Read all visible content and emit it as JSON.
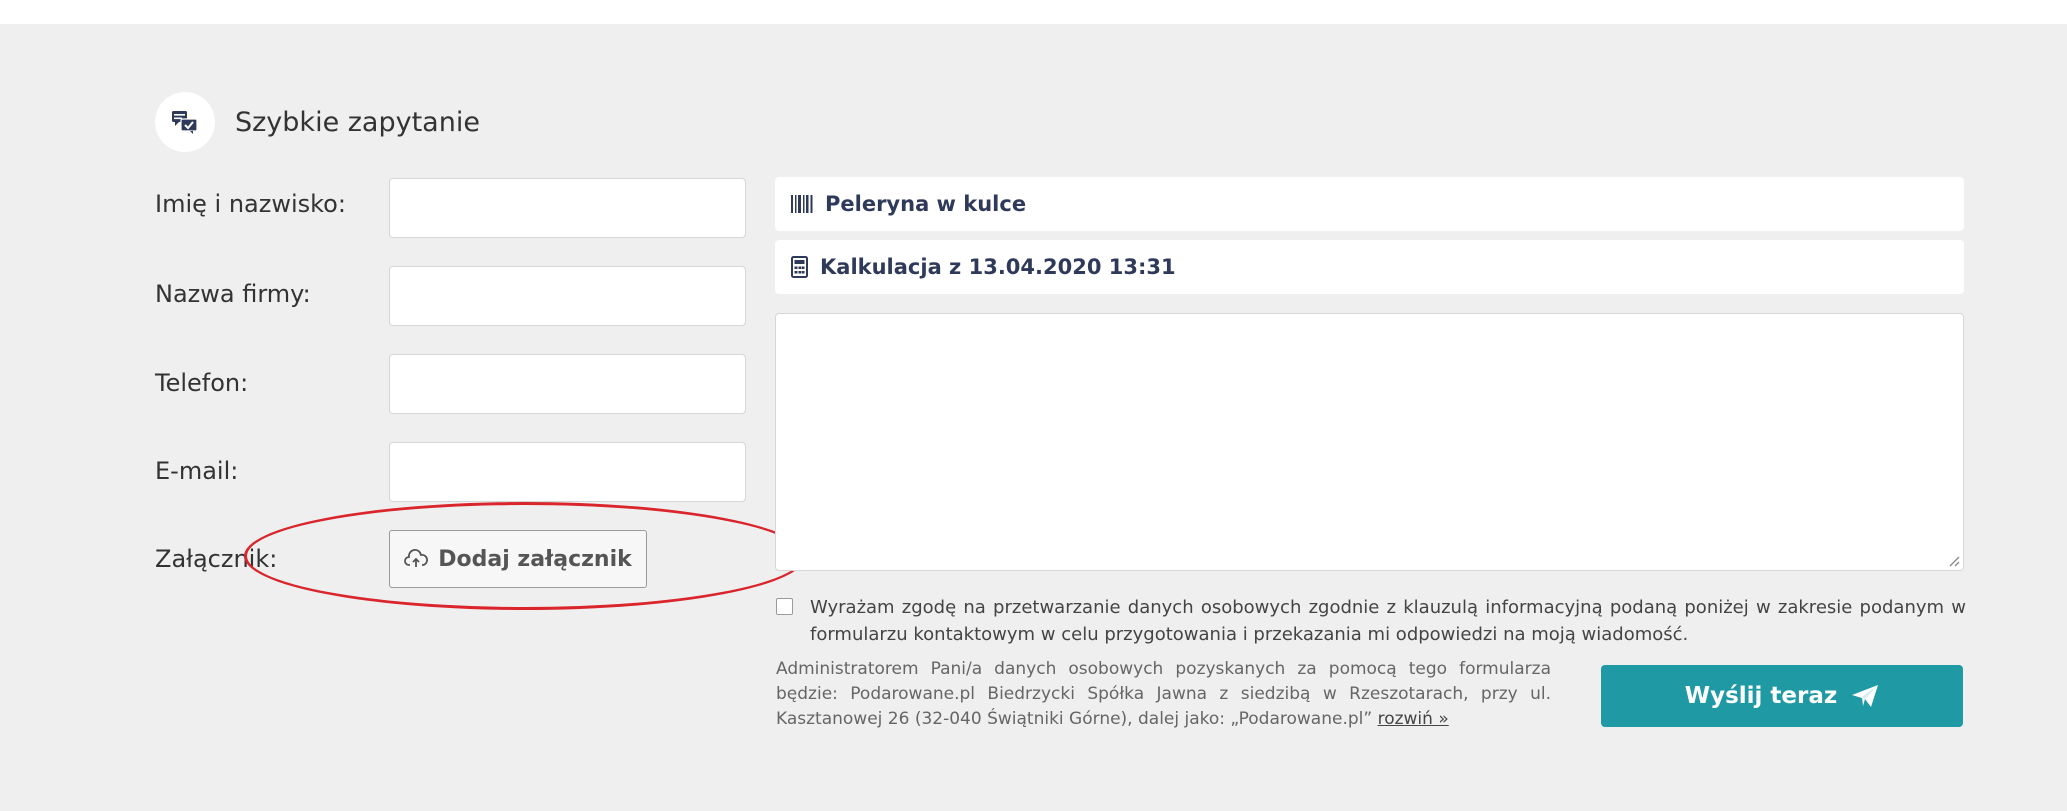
{
  "header": {
    "title": "Szybkie zapytanie",
    "icon": "chat-check-icon"
  },
  "form": {
    "name_label": "Imię i nazwisko:",
    "company_label": "Nazwa firmy:",
    "phone_label": "Telefon:",
    "email_label": "E-mail:",
    "attachment_label": "Załącznik:",
    "attachment_button": "Dodaj załącznik",
    "name_value": "",
    "company_value": "",
    "phone_value": "",
    "email_value": ""
  },
  "product": {
    "label": "Peleryna w kulce",
    "icon": "barcode-icon"
  },
  "calculation": {
    "label": "Kalkulacja z 13.04.2020 13:31",
    "icon": "calculator-icon"
  },
  "message": {
    "value": ""
  },
  "consent": {
    "checked": false,
    "text": "Wyrażam zgodę na przetwarzanie danych osobowych zgodnie z klauzulą informacyjną podaną poniżej w zakresie podanym w formularzu kontaktowym w celu przygotowania i przekazania mi odpowiedzi na moją wiadomość."
  },
  "admin": {
    "text": "Administratorem Pani/a danych osobowych pozyskanych za pomocą tego formularza będzie: Podarowane.pl Biedrzycki Spółka Jawna z siedzibą w Rzeszotarach, przy ul. Kasztanowej 26 (32-040 Świątniki Górne), dalej jako: „Podarowane.pl”",
    "expand_link": "rozwiń »"
  },
  "submit": {
    "label": "Wyślij teraz",
    "icon": "paper-plane-icon"
  },
  "colors": {
    "accent": "#1f9aa4",
    "panel_bg": "#efefef",
    "annotation": "#d9252b"
  }
}
